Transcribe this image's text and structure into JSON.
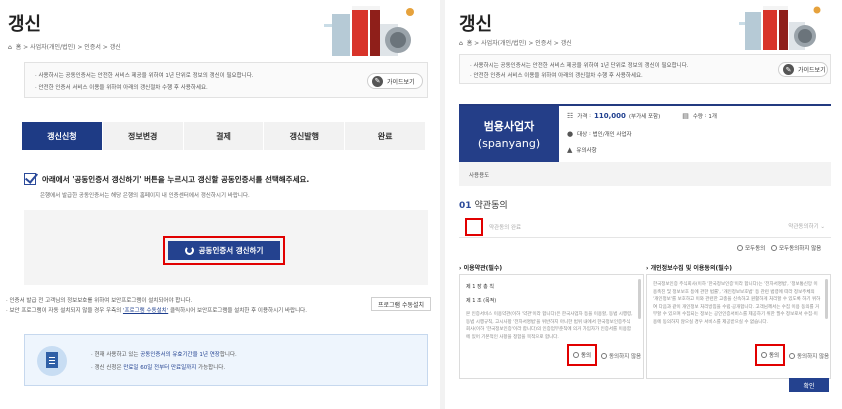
{
  "left": {
    "title": "갱신",
    "breadcrumb": [
      "홈",
      "사업자(개인/법인)",
      "인증서",
      "갱신"
    ],
    "notice": [
      "사용하시는 공동인증서는 안전한 서비스 제공을 위하여 1년 단위로 정보의 갱신이 필요합니다.",
      "안전한 인증서 서비스 이용을 위하여 아래의 갱신절차 수행 후 사용하세요."
    ],
    "guide_button": "가이드보기",
    "steps": [
      "갱신신청",
      "정보변경",
      "결제",
      "갱신발행",
      "완료"
    ],
    "select_title": "아래에서 '공동인증서 갱신하기' 버튼을 누르시고 갱신할 공동인증서를 선택해주세요.",
    "select_sub": "은행에서 발급한 공동인증서는 해당 은행의 홈페이지 내 인증센터에서 갱신하시기 바랍니다.",
    "renew_button": "공동인증서 갱신하기",
    "install_note_1": "인증서 발급 전 고객님의 정보보호를 위하여 보안프로그램이 설치되어야 합니다.",
    "install_note_2a": "보안 프로그램이 자동 설치되지 않을 경우 우측의 ",
    "install_note_2b": "'프로그램 수동설치'",
    "install_note_2c": " 클릭하시어 보안프로그램을 설치한 후 이용하시기 바랍니다.",
    "install_button": "프로그램 수동설치",
    "info_1a": "현재 사용하고 있는 ",
    "info_1b": "공동인증서의 유효기간을 1년 연장",
    "info_1c": "합니다.",
    "info_2a": "갱신 신청은 ",
    "info_2b": "만료일 60일 전부터 만료일까지",
    "info_2c": " 가능합니다."
  },
  "right": {
    "title": "갱신",
    "breadcrumb": [
      "홈",
      "사업자(개인/법인)",
      "인증서",
      "갱신"
    ],
    "notice": [
      "사용하시는 공동인증서는 안전한 서비스 제공을 위하여 1년 단위로 정보의 갱신이 필요합니다.",
      "안전한 인증서 서비스 이용을 위하여 아래의 갱신절차 수행 후 사용하세요."
    ],
    "guide_button": "가이드보기",
    "cert": {
      "name": "범용사업자",
      "id": "(spanyang)",
      "price_label": "가격",
      "price_value": "110,000",
      "price_note": "(부가세 포함)",
      "count_label": "수량",
      "count_value": "1개",
      "target_label": "대상",
      "target_value": "법인/개인 사업자",
      "caution_label": "유의사항",
      "usage_label": "사용용도"
    },
    "section_num": "01",
    "section_title": "약관동의",
    "agree_all_label": "약관동의 완료",
    "more_label": "약관동의하기",
    "all_agree": "모두동의",
    "all_disagree": "모두동의하지 않음",
    "terms_left": {
      "heading": "이용약관(필수)",
      "chapter": "제 1 장 총 칙",
      "article": "제 1 조 (목적)",
      "body": "본 인증서비스 이용약관(이하 '약관'이라 합니다)은 한국사업자 등을 이용할, 동법 시행령, 동법 시행규칙, 고시사항 '전자서명법'을 위반하지 아니한 범위 내에서 한국정보인증주식회사(이하 '한국정보인증'이라 합니다)의 인증업무준칙에 의거 가입자가 인증서를 이용함에 있어 기본적인 사항을 정함을 목적으로 합니다.",
      "agree": "동의",
      "disagree": "동의하지 않음"
    },
    "terms_right": {
      "heading": "개인정보수집 및 이용동의(필수)",
      "body": "한국정보인증 주식회사(이하 '한국정보인증'이라 합니다)는 '전자서명법', '정보통신망 이용촉진 및 정보보호 등에 관한 법률', '개인정보보호법' 등 관련 법령에 따라 정보주체의 '개인정보'를 보호하고 이와 관련한 고충을 신속하고 원활하게 처리할 수 있도록 하기 위하여 다음과 같이 개인정보 처리방침을 수립·공개합니다. 고객님께서는 수집 이용 동의를 거부할 수 있으며 수집되는 정보는 공인인증서비스를 제공하기 위한 필수 정보로서 수집·이용에 동의하지 않으실 경우 서비스를 제공받으실 수 없습니다.",
      "agree": "동의",
      "disagree": "동의하지 않음"
    },
    "confirm_button": "확인"
  },
  "colors": {
    "navy": "#24428f",
    "highlight_red": "#e10000",
    "step_active": "#1e3b85"
  },
  "icons": [
    "home-icon",
    "refresh-icon",
    "check-icon",
    "document-icon",
    "building-illustration"
  ]
}
